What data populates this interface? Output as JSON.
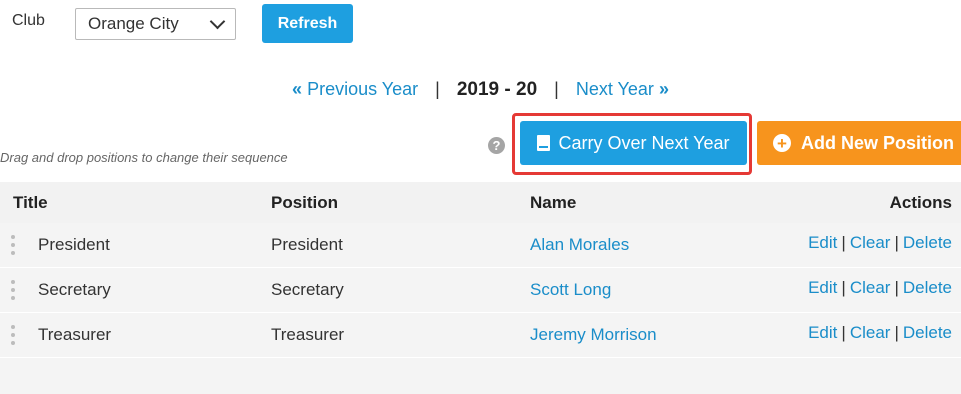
{
  "filter": {
    "club_label": "Club",
    "club_value": "Orange City",
    "refresh_label": "Refresh"
  },
  "year_nav": {
    "prev_label": "Previous Year",
    "current_year": "2019 - 20",
    "next_label": "Next Year",
    "separator": "|"
  },
  "toolbar": {
    "drag_hint": "Drag and drop positions to change their sequence",
    "help_glyph": "?",
    "carry_over_label": "Carry Over Next Year",
    "add_position_label": "Add New Position"
  },
  "table": {
    "headers": {
      "title": "Title",
      "position": "Position",
      "name": "Name",
      "actions": "Actions"
    },
    "action_labels": {
      "edit": "Edit",
      "clear": "Clear",
      "delete": "Delete",
      "separator": "|"
    },
    "rows": [
      {
        "title": "President",
        "position": "President",
        "name": "Alan Morales"
      },
      {
        "title": "Secretary",
        "position": "Secretary",
        "name": "Scott Long"
      },
      {
        "title": "Treasurer",
        "position": "Treasurer",
        "name": "Jeremy Morrison"
      }
    ]
  },
  "colors": {
    "primary_button": "#1e9fe0",
    "add_button": "#f7941d",
    "link": "#1a8dc9",
    "highlight": "#e53935"
  },
  "icons": {
    "select_arrow": "chevron-down-icon",
    "prev_arrow": "double-chevron-left-icon",
    "next_arrow": "double-chevron-right-icon",
    "help": "question-circle-icon",
    "carry_over": "book-icon",
    "add": "plus-circle-icon",
    "drag": "drag-handle-icon"
  }
}
